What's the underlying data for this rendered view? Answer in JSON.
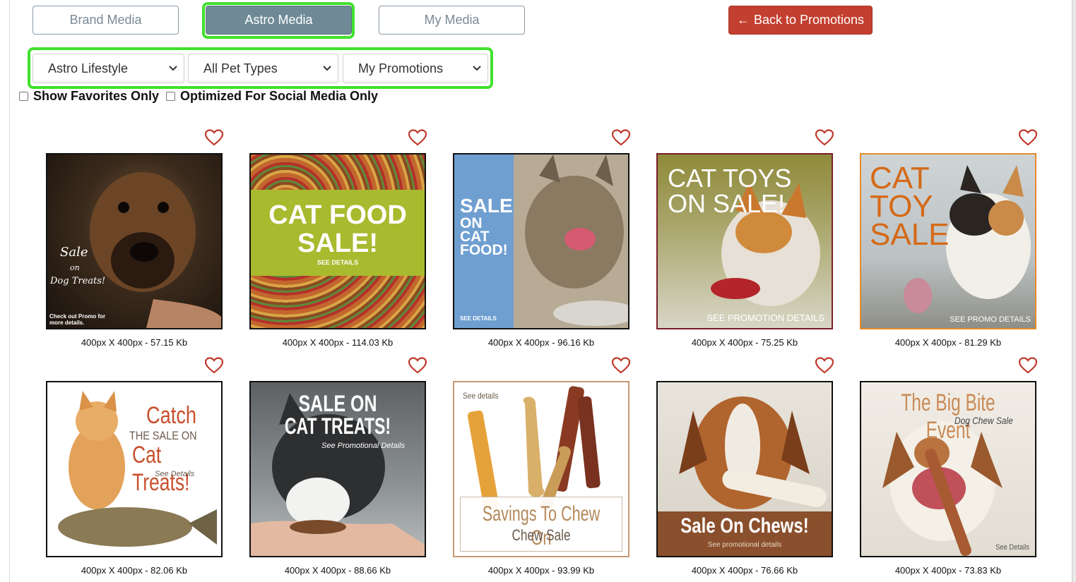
{
  "tabs": [
    {
      "label": "Brand Media",
      "active": false
    },
    {
      "label": "Astro Media",
      "active": true
    },
    {
      "label": "My Media",
      "active": false
    }
  ],
  "back_button": {
    "label": "Back to Promotions",
    "icon": "arrow-left-icon",
    "color": "#c33f2f"
  },
  "filters": {
    "category": "Astro Lifestyle",
    "pet_type": "All Pet Types",
    "promotion": "My Promotions"
  },
  "checkboxes": {
    "favorites": {
      "label": "Show Favorites Only",
      "checked": false
    },
    "social": {
      "label": "Optimized For Social Media Only",
      "checked": false
    }
  },
  "highlight_color": "#41e02c",
  "media": [
    {
      "caption": "400px X 400px - 57.15 Kb",
      "text": [
        "Sale",
        "on",
        "Dog Treats!",
        "Check out Promo for more details."
      ]
    },
    {
      "caption": "400px X 400px - 114.03 Kb",
      "text": [
        "CAT FOOD",
        "SALE!",
        "SEE DETAILS"
      ]
    },
    {
      "caption": "400px X 400px - 96.16 Kb",
      "text": [
        "SALE",
        "ON",
        "CAT",
        "FOOD!",
        "SEE DETAILS"
      ]
    },
    {
      "caption": "400px X 400px - 75.25 Kb",
      "text": [
        "CAT TOYS",
        "ON SALE!",
        "SEE PROMOTION DETAILS"
      ]
    },
    {
      "caption": "400px X 400px - 81.29 Kb",
      "text": [
        "CAT",
        "TOY",
        "SALE",
        "SEE PROMO DETAILS"
      ]
    },
    {
      "caption": "400px X 400px - 82.06 Kb",
      "text": [
        "Catch",
        "THE SALE ON",
        "Cat Treats!",
        "See Details"
      ]
    },
    {
      "caption": "400px X 400px - 88.66 Kb",
      "text": [
        "SALE ON",
        "CAT TREATS!",
        "See Promotional Details"
      ]
    },
    {
      "caption": "400px X 400px - 93.99 Kb",
      "text": [
        "See details",
        "Savings To Chew On",
        "Chew Sale"
      ]
    },
    {
      "caption": "400px X 400px - 76.66 Kb",
      "text": [
        "Sale On Chews!",
        "See promotional details"
      ]
    },
    {
      "caption": "400px X 400px - 73.83 Kb",
      "text": [
        "The Big Bite Event",
        "Dog Chew Sale",
        "See Details"
      ]
    }
  ]
}
